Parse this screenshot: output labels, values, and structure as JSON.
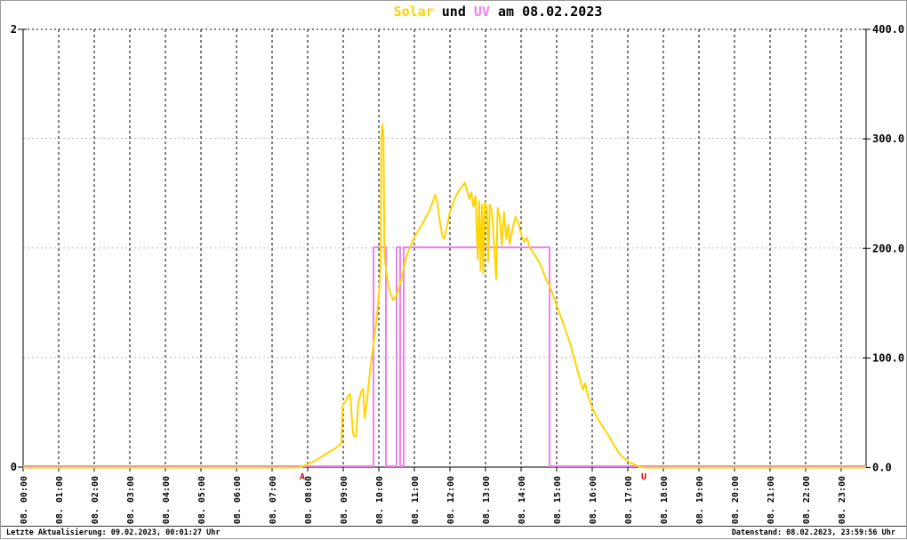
{
  "title": {
    "full": "Solar und UV am 08.02.2023",
    "parts": [
      {
        "text": "Solar",
        "color": "#ffd400"
      },
      {
        "text": " und ",
        "color": "#000000"
      },
      {
        "text": "UV",
        "color": "#ee82ee"
      },
      {
        "text": " am 08.02.2023",
        "color": "#000000"
      }
    ]
  },
  "footer": {
    "left": "Letzte Aktualisierung: 09.02.2023, 00:01:27 Uhr",
    "right": "Datenstand: 08.02.2023, 23:59:56 Uhr"
  },
  "colors": {
    "solar_line": "#ffd400",
    "uv_line": "#ee82ee",
    "sun_marker": "#dd0000",
    "grid_horizontal": "#b8b8b8",
    "grid_vertical": "#000000",
    "axis": "#000000",
    "background": "#ffffff"
  },
  "chart_data": {
    "type": "line",
    "title": "Solar und UV am 08.02.2023",
    "x_axis": {
      "unit": "time",
      "range_hours": [
        0,
        23.7
      ],
      "tick_hours": [
        0,
        1,
        2,
        3,
        4,
        5,
        6,
        7,
        8,
        9,
        10,
        11,
        12,
        13,
        14,
        15,
        16,
        17,
        18,
        19,
        20,
        21,
        22,
        23
      ],
      "tick_labels": [
        "08. 00:00",
        "08. 01:00",
        "08. 02:00",
        "08. 03:00",
        "08. 04:00",
        "08. 05:00",
        "08. 06:00",
        "08. 07:00",
        "08. 08:00",
        "08. 09:00",
        "08. 10:00",
        "08. 11:00",
        "08. 12:00",
        "08. 13:00",
        "08. 14:00",
        "08. 15:00",
        "08. 16:00",
        "08. 17:00",
        "08. 18:00",
        "08. 19:00",
        "08. 20:00",
        "08. 21:00",
        "08. 22:00",
        "08. 23:00"
      ]
    },
    "y_axis_left": {
      "series": "UV",
      "range": [
        0,
        2
      ],
      "ticks": [
        {
          "value": 0,
          "label": "0"
        },
        {
          "value": 2,
          "label": "2"
        }
      ]
    },
    "y_axis_right": {
      "series": "Solar",
      "range": [
        0,
        400
      ],
      "ticks": [
        {
          "value": 0,
          "label": "0.0"
        },
        {
          "value": 100,
          "label": "100.0"
        },
        {
          "value": 200,
          "label": "200.0"
        },
        {
          "value": 300,
          "label": "300.0"
        },
        {
          "value": 400,
          "label": "400.0"
        }
      ],
      "gridline_values": [
        100,
        200,
        300
      ]
    },
    "series": [
      {
        "name": "UV",
        "axis": "left",
        "color": "#ee82ee",
        "type": "step",
        "points": [
          [
            0,
            0
          ],
          [
            9.85,
            0
          ],
          [
            9.85,
            1
          ],
          [
            10.2,
            1
          ],
          [
            10.2,
            0
          ],
          [
            10.5,
            0
          ],
          [
            10.5,
            1
          ],
          [
            10.6,
            1
          ],
          [
            10.6,
            0
          ],
          [
            10.7,
            0
          ],
          [
            10.7,
            1
          ],
          [
            14.8,
            1
          ],
          [
            14.8,
            0
          ],
          [
            23.7,
            0
          ]
        ]
      },
      {
        "name": "Solar",
        "axis": "right",
        "color": "#ffd400",
        "type": "line",
        "points": [
          [
            0,
            0
          ],
          [
            7.7,
            0
          ],
          [
            7.85,
            1
          ],
          [
            8.0,
            3
          ],
          [
            8.2,
            6
          ],
          [
            8.4,
            10
          ],
          [
            8.6,
            14
          ],
          [
            8.8,
            18
          ],
          [
            8.95,
            22
          ],
          [
            8.98,
            56
          ],
          [
            9.05,
            60
          ],
          [
            9.15,
            66
          ],
          [
            9.2,
            67
          ],
          [
            9.24,
            46
          ],
          [
            9.28,
            30
          ],
          [
            9.36,
            28
          ],
          [
            9.42,
            58
          ],
          [
            9.5,
            69
          ],
          [
            9.56,
            72
          ],
          [
            9.6,
            45
          ],
          [
            9.66,
            58
          ],
          [
            9.72,
            78
          ],
          [
            9.78,
            95
          ],
          [
            9.84,
            110
          ],
          [
            9.9,
            125
          ],
          [
            9.96,
            142
          ],
          [
            10.02,
            165
          ],
          [
            10.05,
            190
          ],
          [
            10.07,
            298
          ],
          [
            10.1,
            313
          ],
          [
            10.13,
            305
          ],
          [
            10.16,
            192
          ],
          [
            10.22,
            176
          ],
          [
            10.3,
            162
          ],
          [
            10.4,
            153
          ],
          [
            10.48,
            156
          ],
          [
            10.56,
            163
          ],
          [
            10.64,
            173
          ],
          [
            10.72,
            185
          ],
          [
            10.8,
            195
          ],
          [
            10.9,
            203
          ],
          [
            11.0,
            210
          ],
          [
            11.1,
            216
          ],
          [
            11.2,
            221
          ],
          [
            11.3,
            227
          ],
          [
            11.4,
            233
          ],
          [
            11.5,
            241
          ],
          [
            11.58,
            249
          ],
          [
            11.64,
            243
          ],
          [
            11.7,
            228
          ],
          [
            11.78,
            212
          ],
          [
            11.84,
            209
          ],
          [
            11.92,
            221
          ],
          [
            12.0,
            233
          ],
          [
            12.1,
            243
          ],
          [
            12.2,
            250
          ],
          [
            12.3,
            255
          ],
          [
            12.42,
            260
          ],
          [
            12.48,
            253
          ],
          [
            12.54,
            245
          ],
          [
            12.6,
            251
          ],
          [
            12.66,
            238
          ],
          [
            12.72,
            248
          ],
          [
            12.78,
            190
          ],
          [
            12.82,
            243
          ],
          [
            12.86,
            180
          ],
          [
            12.9,
            240
          ],
          [
            12.94,
            177
          ],
          [
            12.98,
            242
          ],
          [
            13.04,
            237
          ],
          [
            13.08,
            188
          ],
          [
            13.12,
            240
          ],
          [
            13.18,
            234
          ],
          [
            13.24,
            204
          ],
          [
            13.3,
            172
          ],
          [
            13.34,
            237
          ],
          [
            13.4,
            229
          ],
          [
            13.46,
            203
          ],
          [
            13.52,
            233
          ],
          [
            13.58,
            209
          ],
          [
            13.64,
            222
          ],
          [
            13.68,
            204
          ],
          [
            13.76,
            218
          ],
          [
            13.84,
            229
          ],
          [
            13.92,
            224
          ],
          [
            14.0,
            213
          ],
          [
            14.08,
            206
          ],
          [
            14.16,
            210
          ],
          [
            14.24,
            201
          ],
          [
            14.32,
            197
          ],
          [
            14.4,
            193
          ],
          [
            14.5,
            188
          ],
          [
            14.6,
            181
          ],
          [
            14.7,
            172
          ],
          [
            14.8,
            166
          ],
          [
            14.9,
            157
          ],
          [
            15.0,
            148
          ],
          [
            15.1,
            139
          ],
          [
            15.2,
            130
          ],
          [
            15.3,
            121
          ],
          [
            15.4,
            111
          ],
          [
            15.5,
            99
          ],
          [
            15.6,
            87
          ],
          [
            15.68,
            78
          ],
          [
            15.74,
            71
          ],
          [
            15.8,
            77
          ],
          [
            15.86,
            68
          ],
          [
            15.94,
            60
          ],
          [
            16.02,
            53
          ],
          [
            16.1,
            48
          ],
          [
            16.2,
            42
          ],
          [
            16.3,
            37
          ],
          [
            16.4,
            32
          ],
          [
            16.5,
            27
          ],
          [
            16.6,
            21
          ],
          [
            16.7,
            16
          ],
          [
            16.8,
            11
          ],
          [
            16.95,
            7
          ],
          [
            17.1,
            4
          ],
          [
            17.3,
            1
          ],
          [
            17.45,
            0
          ],
          [
            23.7,
            0
          ]
        ]
      }
    ],
    "annotations": [
      {
        "text": "A",
        "time": 7.85,
        "color": "#dd0000"
      },
      {
        "text": "U",
        "time": 17.45,
        "color": "#dd0000"
      }
    ],
    "layout": {
      "grid": true,
      "legend": "none"
    }
  }
}
